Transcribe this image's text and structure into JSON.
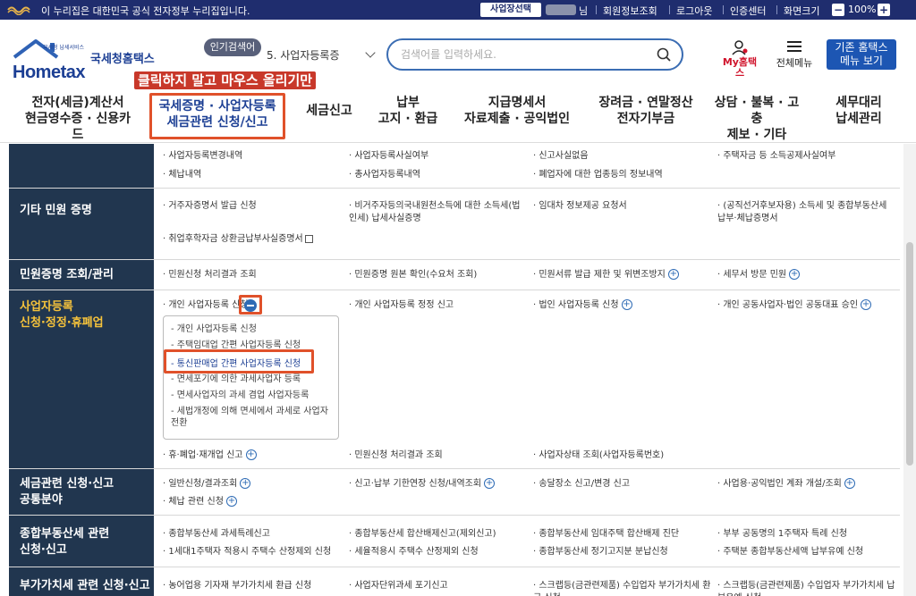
{
  "topbar": {
    "gov_notice": "이 누리집은 대한민국 공식 전자정부 누리집입니다.",
    "business_btn": "사업장선택",
    "nim": "님",
    "links": [
      "회원정보조회",
      "로그아웃",
      "인증센터",
      "화면크기"
    ],
    "zoom_minus": "−",
    "zoom_level": "100%",
    "zoom_plus": "+"
  },
  "header": {
    "logo_text": "Hometax",
    "logo_sub": "국세청 납세서비스",
    "logo_kor": "국세청홈택스",
    "popular_badge": "인기검색어",
    "popular_item": "5. 사업자등록증",
    "search_placeholder": "검색어를 입력하세요.",
    "myhome": "My홈택스",
    "allmenu": "전체메뉴",
    "old_home_line1": "기존 홈택스",
    "old_home_line2": "메뉴 보기"
  },
  "annotation": "클릭하지 말고 마우스 올리기만",
  "nav": [
    {
      "l1": "전자(세금)계산서",
      "l2": "현금영수증 · 신용카드"
    },
    {
      "l1": "국세증명 · 사업자등록",
      "l2": "세금관련 신청/신고"
    },
    {
      "l1": "세금신고",
      "l2": ""
    },
    {
      "l1": "납부",
      "l2": "고지 · 환급"
    },
    {
      "l1": "지급명세서",
      "l2": "자료제출 · 공익법인"
    },
    {
      "l1": "장려금 · 연말정산",
      "l2": "전자기부금"
    },
    {
      "l1": "상담 · 불복 · 고충",
      "l2": "제보 · 기타"
    },
    {
      "l1": "세무대리",
      "l2": "납세관리"
    }
  ],
  "rows": {
    "r0": [
      "· 사업자등록변경내역",
      "· 사업자등록사실여부",
      "· 신고사실없음",
      "· 주택자금 등 소득공제사실여부",
      "· 체납내역",
      "· 총사업자등록내역",
      "· 폐업자에 대한 업종등의 정보내역"
    ],
    "r1_cat": "기타 민원 증명",
    "r1": [
      "· 거주자증명서 발급 신청",
      "· 비거주자등의국내원천소득에 대한 소득세(법인세) 납세사실증명",
      "· 임대차 정보제공 요청서",
      "· (공직선거후보자용) 소득세 및 종합부동산세 납부·체납증명서",
      "· 취업후학자금 상환금납부사실증명서"
    ],
    "r2_cat": "민원증명 조회/관리",
    "r2": [
      "· 민원신청 처리결과 조회",
      "· 민원증명 원본 확인(수요처 조회)",
      "· 민원서류 발급 제한 및 위변조방지",
      "· 세무서 방문 민원"
    ],
    "r3_cat1": "사업자등록",
    "r3_cat2": "신청·정정·휴폐업",
    "r3": [
      "· 개인 사업자등록 신청",
      "· 개인 사업자등록 정정 신고",
      "· 법인 사업자등록 신청",
      "· 개인 공동사업자·법인 공동대표 승인",
      "· 휴·폐업·재개업 신고",
      "· 민원신청 처리결과 조회",
      "· 사업자상태 조회(사업자등록번호)"
    ],
    "r3_sub": [
      "- 개인 사업자등록 신청",
      "- 주택임대업 간편 사업자등록 신청",
      "- 통신판매업 간편 사업자등록 신청",
      "- 면세포기에 의한 과세사업자 등록",
      "- 면세사업자의 과세 겸업 사업자등록",
      "- 세법개정에 의해 면세에서 과세로 사업자 전환"
    ],
    "r4_cat1": "세금관련 신청·신고",
    "r4_cat2": "공통분야",
    "r4": [
      "· 일반신청/결과조회",
      "· 신고·납부 기한연장 신청/내역조회",
      "· 송달장소 신고/변경 신고",
      "· 사업용·공익법인 계좌 개설/조회",
      "· 체납 관련 신청"
    ],
    "r5_cat1": "종합부동산세 관련",
    "r5_cat2": "신청·신고",
    "r5": [
      "· 종합부동산세 과세특례신고",
      "· 종합부동산세 합산배제신고(제외신고)",
      "· 종합부동산세 임대주택 합산배제 진단",
      "· 부부 공동명의 1주택자 특례 신청",
      "· 1세대1주택자 적용시 주택수 산정제외 신청",
      "· 세율적용시 주택수 산정제외 신청",
      "· 종합부동산세 정기고지분 분납신청",
      "· 주택분 종합부동산세액 납부유예 신청"
    ],
    "r6_cat": "부가가치세 관련 신청·신고",
    "r6": [
      "· 농어업용 기자재 부가가치세 환급 신청",
      "· 사업자단위과세 포기신고",
      "· 스크랩등(금관련제품) 수입업자 부가가치세 환급 신청",
      "· 스크랩등(금관련제품) 수입업자 부가가치세 납부유예 신청"
    ]
  }
}
